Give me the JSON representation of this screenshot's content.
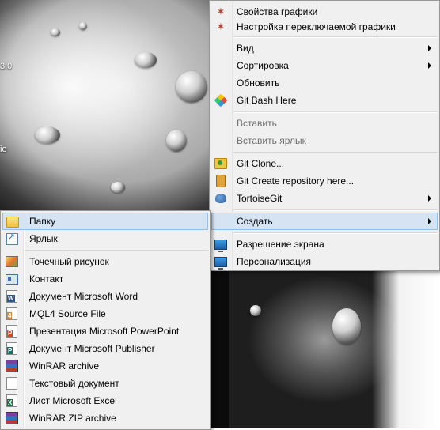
{
  "desktop": {
    "label_top": "3.0",
    "label_mid": "io"
  },
  "main_menu": {
    "items": [
      {
        "label": "Свойства графики",
        "icon": "graphics-properties-icon",
        "disabled": false,
        "submenu": false
      },
      {
        "label": "Настройка переключаемой графики",
        "icon": "switchable-graphics-icon",
        "disabled": false,
        "submenu": false
      },
      {
        "label": "Вид",
        "icon": "",
        "disabled": false,
        "submenu": true
      },
      {
        "label": "Сортировка",
        "icon": "",
        "disabled": false,
        "submenu": true
      },
      {
        "label": "Обновить",
        "icon": "",
        "disabled": false,
        "submenu": false
      },
      {
        "label": "Git Bash Here",
        "icon": "git-bash-icon",
        "disabled": false,
        "submenu": false
      },
      {
        "label": "Вставить",
        "icon": "",
        "disabled": true,
        "submenu": false
      },
      {
        "label": "Вставить ярлык",
        "icon": "",
        "disabled": true,
        "submenu": false
      },
      {
        "label": "Git Clone...",
        "icon": "git-clone-icon",
        "disabled": false,
        "submenu": false
      },
      {
        "label": "Git Create repository here...",
        "icon": "git-create-repo-icon",
        "disabled": false,
        "submenu": false
      },
      {
        "label": "TortoiseGit",
        "icon": "tortoisegit-icon",
        "disabled": false,
        "submenu": true
      },
      {
        "label": "Создать",
        "icon": "",
        "disabled": false,
        "submenu": true,
        "highlighted": true
      },
      {
        "label": "Разрешение экрана",
        "icon": "screen-resolution-icon",
        "disabled": false,
        "submenu": false
      },
      {
        "label": "Персонализация",
        "icon": "personalization-icon",
        "disabled": false,
        "submenu": false
      }
    ]
  },
  "sub_menu": {
    "items": [
      {
        "label": "Папку",
        "icon": "folder-icon",
        "highlighted": true
      },
      {
        "label": "Ярлык",
        "icon": "shortcut-icon"
      },
      {
        "label": "Точечный рисунок",
        "icon": "bitmap-icon"
      },
      {
        "label": "Контакт",
        "icon": "contact-icon"
      },
      {
        "label": "Документ Microsoft Word",
        "icon": "word-document-icon"
      },
      {
        "label": "MQL4 Source File",
        "icon": "mql4-file-icon"
      },
      {
        "label": "Презентация Microsoft PowerPoint",
        "icon": "powerpoint-icon"
      },
      {
        "label": "Документ Microsoft Publisher",
        "icon": "publisher-icon"
      },
      {
        "label": "WinRAR archive",
        "icon": "winrar-icon"
      },
      {
        "label": "Текстовый документ",
        "icon": "text-document-icon"
      },
      {
        "label": "Лист Microsoft Excel",
        "icon": "excel-icon"
      },
      {
        "label": "WinRAR ZIP archive",
        "icon": "winrar-zip-icon"
      }
    ]
  }
}
